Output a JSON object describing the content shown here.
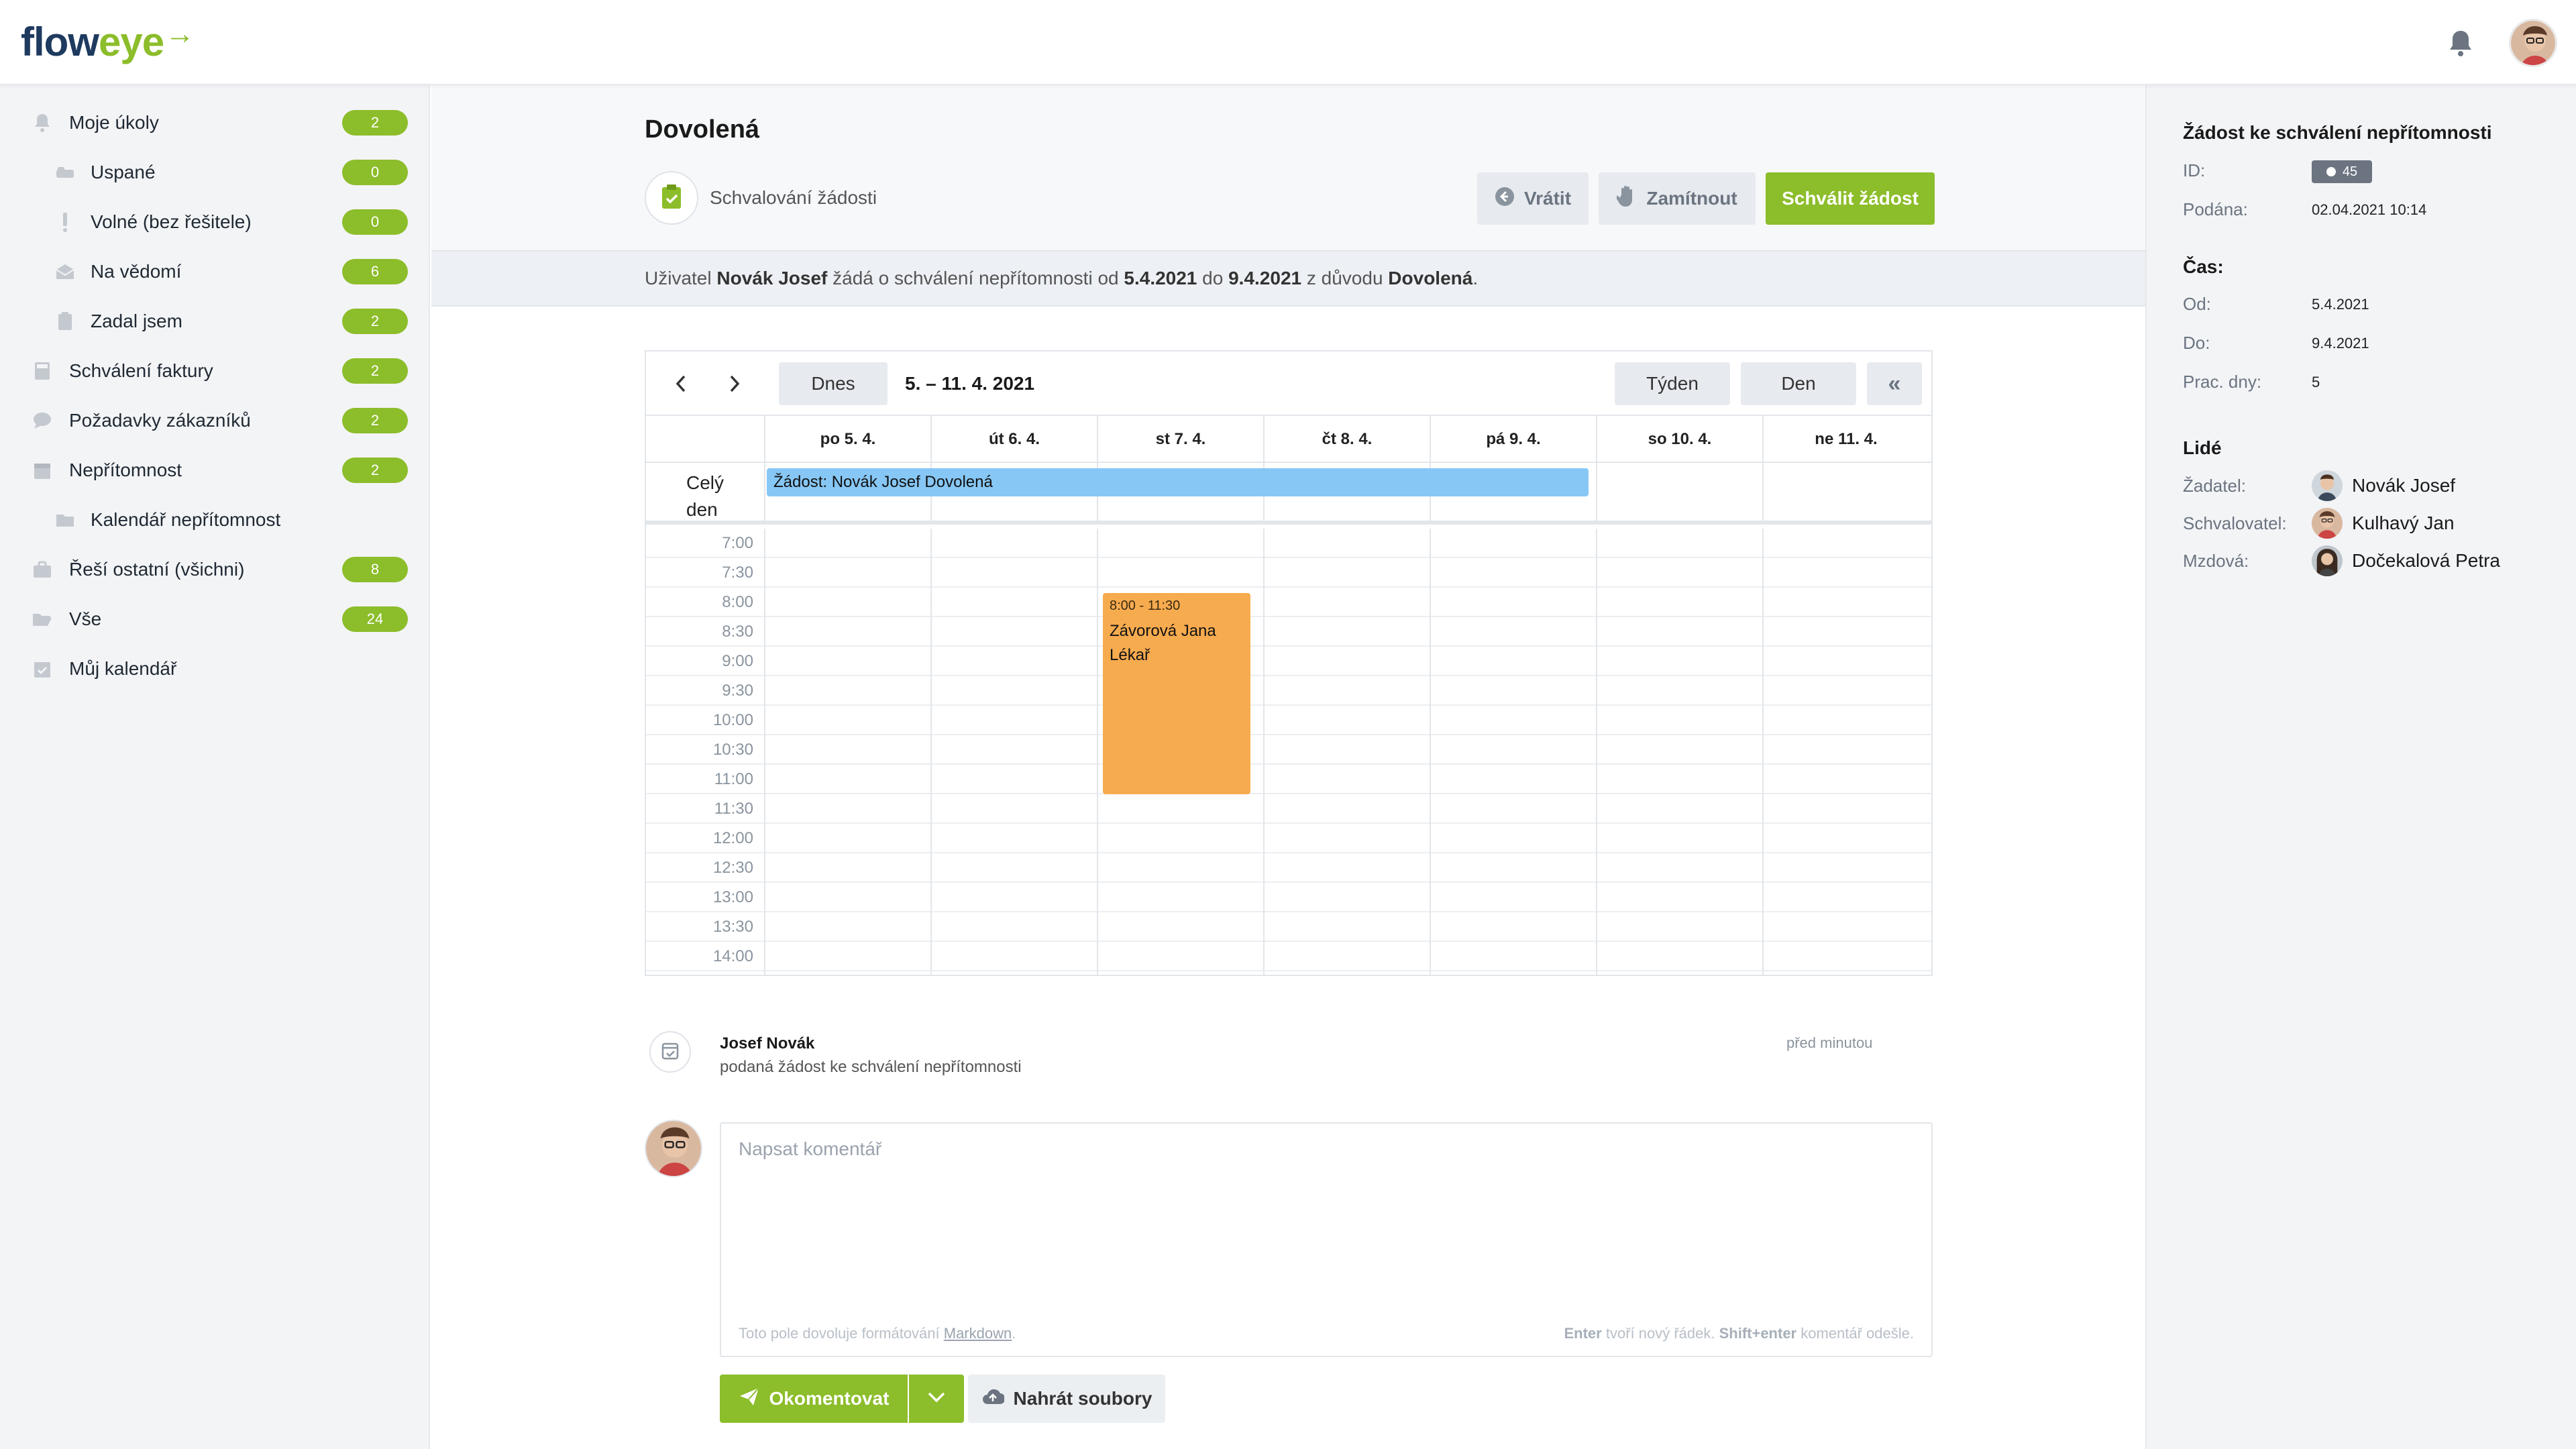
{
  "logo": {
    "part1": "flow",
    "part2": "eye",
    "arrow": "→"
  },
  "sidebar": {
    "items": [
      {
        "label": "Moje úkoly",
        "badge": "2",
        "icon": "bell-icon"
      },
      {
        "label": "Uspané",
        "badge": "0",
        "icon": "sleep-icon"
      },
      {
        "label": "Volné (bez řešitele)",
        "badge": "0",
        "icon": "exclamation-icon"
      },
      {
        "label": "Na vědomí",
        "badge": "6",
        "icon": "envelope-icon"
      },
      {
        "label": "Zadal jsem",
        "badge": "2",
        "icon": "clipboard-icon"
      },
      {
        "label": "Schválení faktury",
        "badge": "2",
        "icon": "calculator-icon"
      },
      {
        "label": "Požadavky zákazníků",
        "badge": "2",
        "icon": "chat-icon"
      },
      {
        "label": "Nepřítomnost",
        "badge": "2",
        "icon": "calendar-icon"
      },
      {
        "label": "Kalendář nepřítomnost",
        "badge": "",
        "icon": "folder-icon"
      },
      {
        "label": "Řeší ostatní (všichni)",
        "badge": "8",
        "icon": "briefcase-icon"
      },
      {
        "label": "Vše",
        "badge": "24",
        "icon": "folder-open-icon"
      },
      {
        "label": "Můj kalendář",
        "badge": "",
        "icon": "calendar-check-icon"
      }
    ]
  },
  "main": {
    "title": "Dovolená",
    "step_label": "Schvalování žádosti",
    "buttons": {
      "return": "Vrátit",
      "reject": "Zamítnout",
      "approve": "Schválit žádost"
    },
    "info": {
      "p1": "Uživatel ",
      "user": "Novák Josef",
      "p2": " žádá o schválení nepřítomnosti od ",
      "from": "5.4.2021",
      "p3": " do ",
      "to": "9.4.2021",
      "p4": " z důvodu ",
      "reason": "Dovolená",
      "p5": "."
    }
  },
  "calendar": {
    "today": "Dnes",
    "range": "5. – 11. 4. 2021",
    "week": "Týden",
    "day": "Den",
    "collapse": "«",
    "days": [
      "po 5. 4.",
      "út 6. 4.",
      "st 7. 4.",
      "čt 8. 4.",
      "pá 9. 4.",
      "so 10. 4.",
      "ne 11. 4."
    ],
    "allday_label_1": "Celý",
    "allday_label_2": "den",
    "allday_event": "Žádost: Novák Josef Dovolená",
    "times": [
      "7:00",
      "7:30",
      "8:00",
      "8:30",
      "9:00",
      "9:30",
      "10:00",
      "10:30",
      "11:00",
      "11:30",
      "12:00",
      "12:30",
      "13:00",
      "13:30",
      "14:00"
    ],
    "event": {
      "time": "8:00 - 11:30",
      "name": "Závorová Jana",
      "type": "Lékař",
      "color": "#f7ab4f"
    }
  },
  "activity": {
    "name": "Josef Novák",
    "desc": "podaná žádost ke schválení nepřítomnosti",
    "time": "před minutou"
  },
  "comment": {
    "placeholder": "Napsat komentář",
    "hint_left_1": "Toto pole dovoluje formátování ",
    "hint_left_link": "Markdown",
    "hint_left_2": ".",
    "hint_right_k1": "Enter",
    "hint_right_t1": " tvoří nový řádek. ",
    "hint_right_k2": "Shift+enter",
    "hint_right_t2": " komentář odešle.",
    "submit": "Okomentovat",
    "upload": "Nahrát soubory"
  },
  "detail": {
    "title": "Žádost ke schválení nepřítomnosti",
    "id_label": "ID:",
    "id_value": "45",
    "submitted_label": "Podána:",
    "submitted_value": "02.04.2021 10:14",
    "time_title": "Čas:",
    "from_label": "Od:",
    "from_value": "5.4.2021",
    "to_label": "Do:",
    "to_value": "9.4.2021",
    "workdays_label": "Prac. dny:",
    "workdays_value": "5",
    "people_title": "Lidé",
    "people": [
      {
        "role": "Žadatel:",
        "name": "Novák Josef"
      },
      {
        "role": "Schvalovatel:",
        "name": "Kulhavý Jan"
      },
      {
        "role": "Mzdová:",
        "name": "Dočekalová Petra"
      }
    ]
  },
  "colors": {
    "accent": "#8cbd2a",
    "brand_dark": "#1f3a5f",
    "allday_event": "#87c7f5",
    "timed_event": "#f7ab4f"
  }
}
